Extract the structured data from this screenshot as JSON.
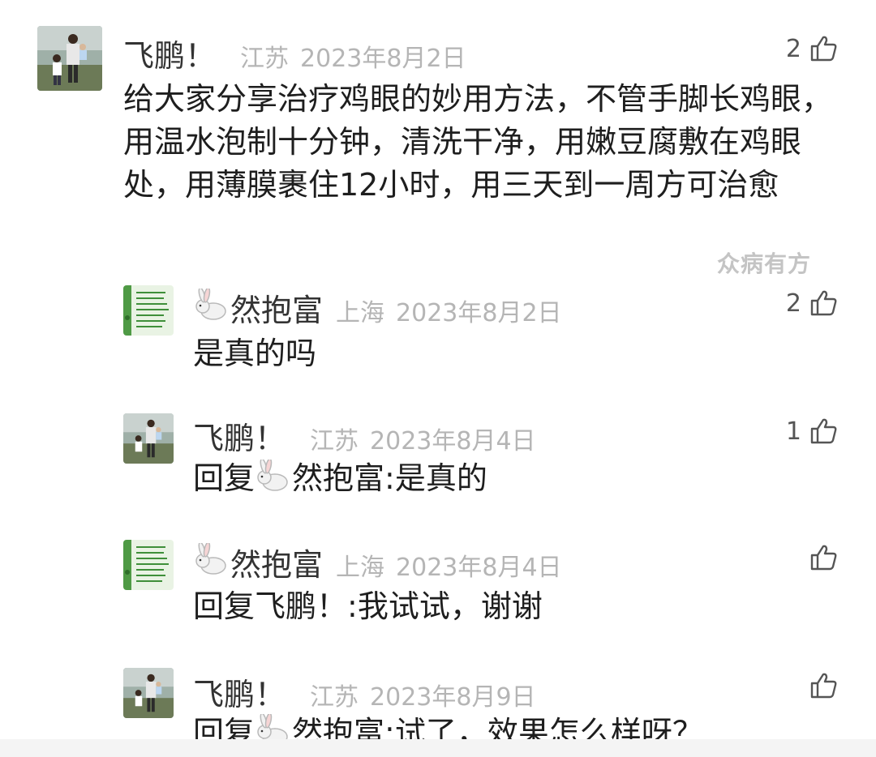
{
  "main_comment": {
    "user_name": "飞鹏！",
    "region": "江苏",
    "date": "2023年8月2日",
    "like_count": "2",
    "text": "给大家分享治疗鸡眼的妙用方法，不管手脚长鸡眼，用温水泡制十分钟，清洗干净，用嫩豆腐敷在鸡眼处，用薄膜裹住12小时，用三天到一周方可治愈",
    "watermark": "众病有方"
  },
  "replies": [
    {
      "user_name": "然抱富",
      "region": "上海",
      "date": "2023年8月2日",
      "like_count": "2",
      "text": "是真的吗"
    },
    {
      "user_name": "飞鹏！",
      "region": "江苏",
      "date": "2023年8月4日",
      "like_count": "1",
      "reply_prefix": "回复",
      "reply_to": "然抱富",
      "reply_text": ":是真的"
    },
    {
      "user_name": "然抱富",
      "region": "上海",
      "date": "2023年8月4日",
      "like_count": "",
      "reply_prefix": "回复",
      "reply_to": "飞鹏！",
      "reply_text": ":我试试，谢谢"
    },
    {
      "user_name": "飞鹏！",
      "region": "江苏",
      "date": "2023年8月9日",
      "like_count": "",
      "reply_prefix": "回复",
      "reply_to": "然抱富",
      "reply_text": ":试了，效果怎么样呀？"
    }
  ],
  "icons": {
    "like": "thumbs-up-icon",
    "rabbit": "rabbit-emoji-icon",
    "avatar_photo": "father-child-photo-avatar",
    "avatar_text": "green-text-avatar"
  },
  "colors": {
    "meta_gray": "#b5b5b5",
    "text": "#1e1e1e",
    "avatar_green": "#3f8f3a"
  }
}
